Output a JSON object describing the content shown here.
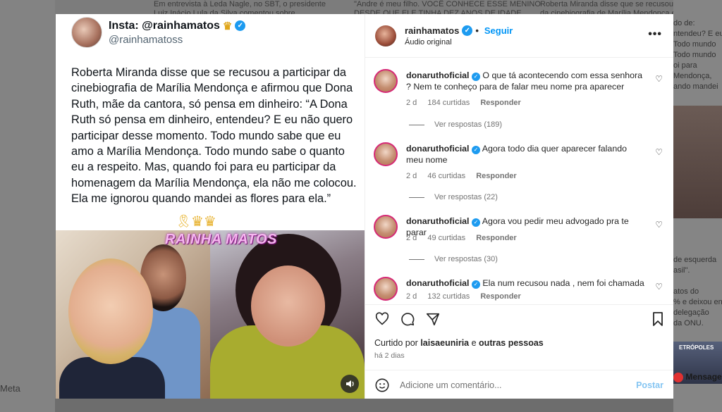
{
  "background": {
    "left_label": "Meta",
    "top_texts": [
      "Em entrevista à Leda Nagle, no SBT, o presidente",
      "Luiz Inácio Lula da Silva comentou sobre",
      "\"Andre é meu filho. VOCÊ CONHECE ESSE MENINO",
      "DESDE QUE ELE TINHA DEZ ANOS DE IDADE.",
      "Roberta Miranda disse que se recusou a participar",
      "da cinebiografia de Marília Mendonça e afirmou que"
    ],
    "right_texts": [
      "do de:",
      "ntendeu? E eu",
      "Todo mundo",
      "Todo mundo",
      "oi para",
      "Mendonça,",
      "ando mandei"
    ],
    "right_texts_lower": [
      "de esquerda",
      "asil\".",
      "",
      "atos do",
      "% e deixou en",
      "delegação",
      "da ONU."
    ],
    "right_badge": "Mensage",
    "right_small": "ETRÓPOLES"
  },
  "tweet": {
    "name": "Insta: @rainhamatos",
    "handle": "@rainhamatoss",
    "text": "Roberta Miranda disse que se recusou a participar da cinebiografia de Marília Mendonça e afirmou que Dona Ruth, mãe da cantora, só pensa em dinheiro: “A Dona Ruth só pensa em dinheiro, entendeu? E eu não quero participar desse momento. Todo mundo sabe que eu amo a Marília Mendonça. Todo mundo sabe o quanto eu a respeito. Mas, quando foi para eu participar da homenagem da Marília Mendonça, ela não me colocou. Ela me ignorou quando mandei as flores para ela.”",
    "overlay_logo": "RAINHA MATOS"
  },
  "post": {
    "username": "rainhamatos",
    "follow_label": "Seguir",
    "audio": "Áudio original",
    "comments": [
      {
        "user": "donaruthoficial",
        "text": "O que tá acontecendo com essa senhora ? Nem te conheço para de falar meu nome pra aparecer",
        "time": "2 d",
        "likes": "184 curtidas",
        "reply": "Responder",
        "view_replies": "Ver respostas (189)"
      },
      {
        "user": "donaruthoficial",
        "text": "Agora todo dia quer aparecer falando meu nome",
        "time": "2 d",
        "likes": "46 curtidas",
        "reply": "Responder",
        "view_replies": "Ver respostas (22)"
      },
      {
        "user": "donaruthoficial",
        "text": "Agora vou pedir meu advogado pra te parar",
        "time": "2 d",
        "likes": "49 curtidas",
        "reply": "Responder",
        "view_replies": "Ver respostas (30)"
      },
      {
        "user": "donaruthoficial",
        "text": "Ela num recusou nada , nem foi chamada",
        "time": "2 d",
        "likes": "132 curtidas",
        "reply": "Responder"
      }
    ],
    "liked_by_prefix": "Curtido por",
    "liked_by_user": "laisaeuniria",
    "liked_by_join": "e",
    "liked_by_others": "outras pessoas",
    "posted_time": "há 2 dias",
    "comment_placeholder": "Adicione um comentário...",
    "post_label": "Postar"
  },
  "colors": {
    "accent": "#0095f6",
    "verified": "#1d9bf0",
    "story_ring": "#d62976"
  }
}
